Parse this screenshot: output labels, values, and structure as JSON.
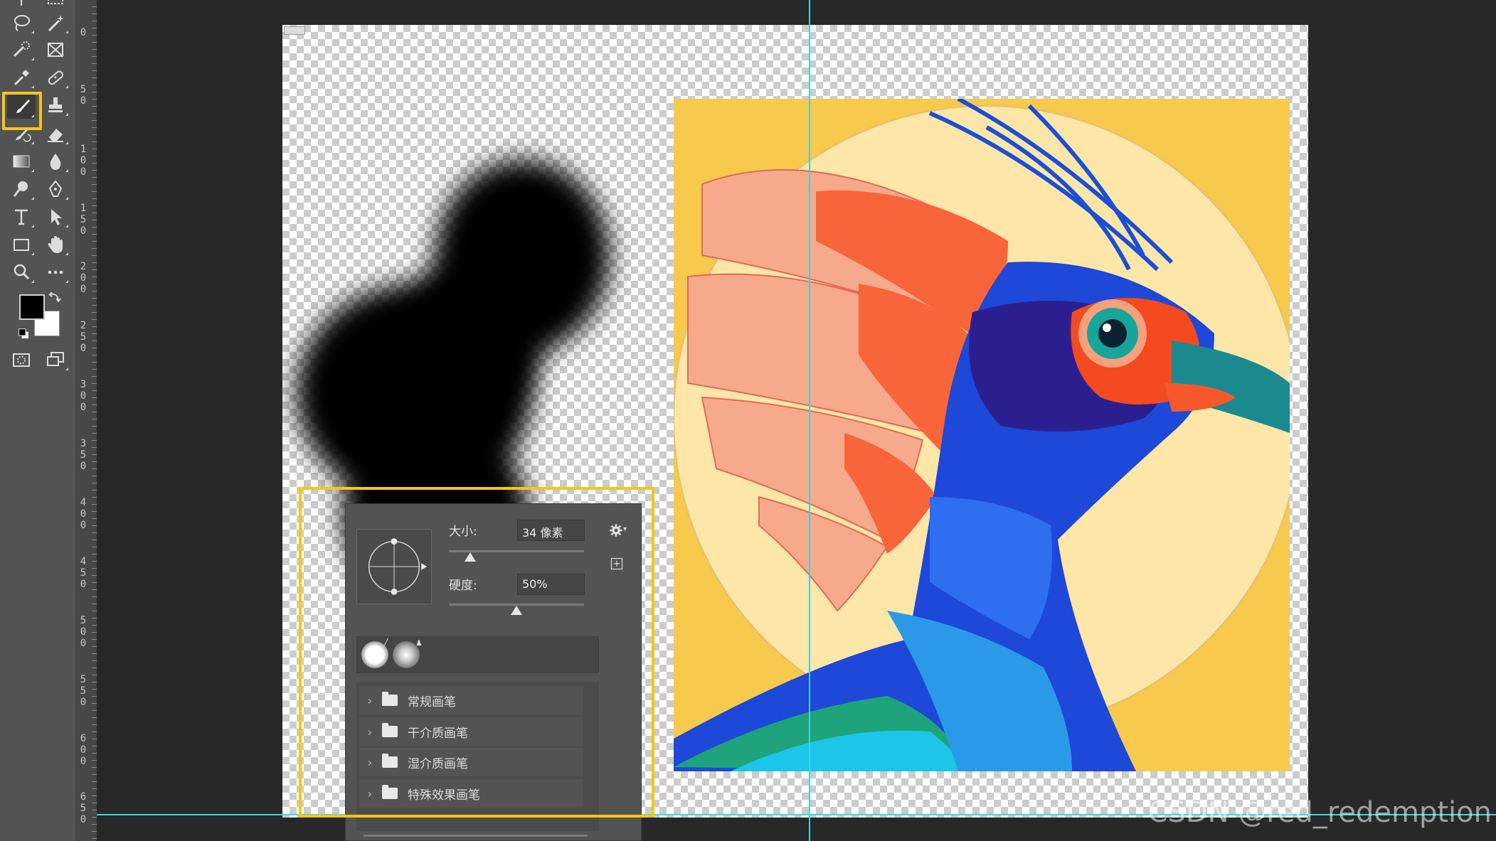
{
  "toolbar": {
    "tools": [
      {
        "name": "lasso-tool",
        "icon": "lasso-icon"
      },
      {
        "name": "magic-wand-tool",
        "icon": "magic-wand-icon"
      },
      {
        "name": "quick-selection-tool",
        "icon": "quick-selection-icon"
      },
      {
        "name": "frame-tool",
        "icon": "frame-icon"
      },
      {
        "name": "eyedropper-tool",
        "icon": "eyedropper-icon"
      },
      {
        "name": "healing-brush-tool",
        "icon": "bandage-icon"
      },
      {
        "name": "brush-tool",
        "icon": "brush-icon",
        "active": true
      },
      {
        "name": "clone-stamp-tool",
        "icon": "stamp-icon"
      },
      {
        "name": "history-brush-tool",
        "icon": "history-brush-icon"
      },
      {
        "name": "eraser-tool",
        "icon": "eraser-icon"
      },
      {
        "name": "gradient-tool",
        "icon": "gradient-icon"
      },
      {
        "name": "blur-tool",
        "icon": "drop-icon"
      },
      {
        "name": "dodge-tool",
        "icon": "dodge-icon"
      },
      {
        "name": "pen-tool",
        "icon": "pen-icon"
      },
      {
        "name": "type-tool",
        "icon": "type-icon"
      },
      {
        "name": "path-selection-tool",
        "icon": "arrow-icon"
      },
      {
        "name": "rectangle-tool",
        "icon": "rectangle-icon"
      },
      {
        "name": "hand-tool",
        "icon": "hand-icon"
      },
      {
        "name": "zoom-tool",
        "icon": "zoom-icon"
      },
      {
        "name": "edit-toolbar",
        "icon": "more-icon"
      }
    ],
    "foreground_color": "#000000",
    "background_color": "#ffffff"
  },
  "ruler": {
    "labels": [
      "0",
      "50",
      "100",
      "150",
      "200",
      "250",
      "300",
      "350",
      "400",
      "450",
      "500",
      "550",
      "600",
      "650"
    ]
  },
  "brush_panel": {
    "size_label": "大小:",
    "size_value": "34 像素",
    "size_fraction": 0.16,
    "hardness_label": "硬度:",
    "hardness_value": "50%",
    "hardness_fraction": 0.5,
    "folders": [
      {
        "label": "常规画笔"
      },
      {
        "label": "干介质画笔"
      },
      {
        "label": "湿介质画笔"
      },
      {
        "label": "特殊效果画笔"
      }
    ]
  },
  "colors": {
    "highlight": "#f5c518",
    "guide": "#38d6e6"
  },
  "watermark": "CSDN @red_redemption"
}
